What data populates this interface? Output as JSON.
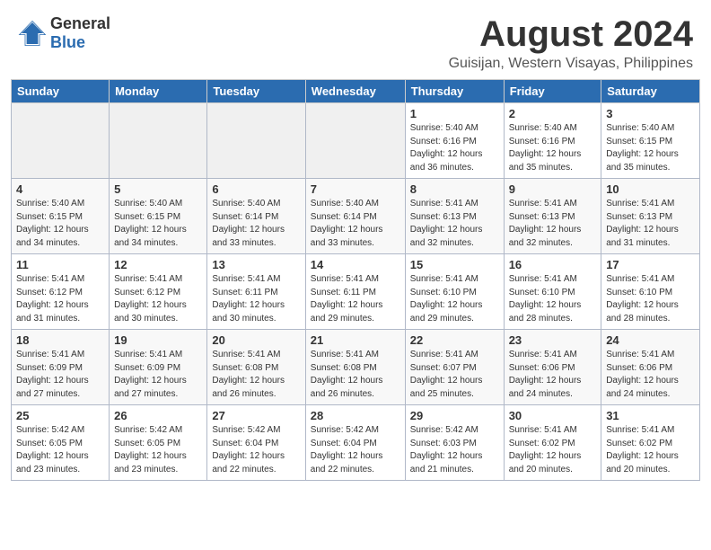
{
  "logo": {
    "general": "General",
    "blue": "Blue"
  },
  "title": {
    "month_year": "August 2024",
    "location": "Guisijan, Western Visayas, Philippines"
  },
  "headers": [
    "Sunday",
    "Monday",
    "Tuesday",
    "Wednesday",
    "Thursday",
    "Friday",
    "Saturday"
  ],
  "weeks": [
    [
      {
        "day": "",
        "info": ""
      },
      {
        "day": "",
        "info": ""
      },
      {
        "day": "",
        "info": ""
      },
      {
        "day": "",
        "info": ""
      },
      {
        "day": "1",
        "info": "Sunrise: 5:40 AM\nSunset: 6:16 PM\nDaylight: 12 hours\nand 36 minutes."
      },
      {
        "day": "2",
        "info": "Sunrise: 5:40 AM\nSunset: 6:16 PM\nDaylight: 12 hours\nand 35 minutes."
      },
      {
        "day": "3",
        "info": "Sunrise: 5:40 AM\nSunset: 6:15 PM\nDaylight: 12 hours\nand 35 minutes."
      }
    ],
    [
      {
        "day": "4",
        "info": "Sunrise: 5:40 AM\nSunset: 6:15 PM\nDaylight: 12 hours\nand 34 minutes."
      },
      {
        "day": "5",
        "info": "Sunrise: 5:40 AM\nSunset: 6:15 PM\nDaylight: 12 hours\nand 34 minutes."
      },
      {
        "day": "6",
        "info": "Sunrise: 5:40 AM\nSunset: 6:14 PM\nDaylight: 12 hours\nand 33 minutes."
      },
      {
        "day": "7",
        "info": "Sunrise: 5:40 AM\nSunset: 6:14 PM\nDaylight: 12 hours\nand 33 minutes."
      },
      {
        "day": "8",
        "info": "Sunrise: 5:41 AM\nSunset: 6:13 PM\nDaylight: 12 hours\nand 32 minutes."
      },
      {
        "day": "9",
        "info": "Sunrise: 5:41 AM\nSunset: 6:13 PM\nDaylight: 12 hours\nand 32 minutes."
      },
      {
        "day": "10",
        "info": "Sunrise: 5:41 AM\nSunset: 6:13 PM\nDaylight: 12 hours\nand 31 minutes."
      }
    ],
    [
      {
        "day": "11",
        "info": "Sunrise: 5:41 AM\nSunset: 6:12 PM\nDaylight: 12 hours\nand 31 minutes."
      },
      {
        "day": "12",
        "info": "Sunrise: 5:41 AM\nSunset: 6:12 PM\nDaylight: 12 hours\nand 30 minutes."
      },
      {
        "day": "13",
        "info": "Sunrise: 5:41 AM\nSunset: 6:11 PM\nDaylight: 12 hours\nand 30 minutes."
      },
      {
        "day": "14",
        "info": "Sunrise: 5:41 AM\nSunset: 6:11 PM\nDaylight: 12 hours\nand 29 minutes."
      },
      {
        "day": "15",
        "info": "Sunrise: 5:41 AM\nSunset: 6:10 PM\nDaylight: 12 hours\nand 29 minutes."
      },
      {
        "day": "16",
        "info": "Sunrise: 5:41 AM\nSunset: 6:10 PM\nDaylight: 12 hours\nand 28 minutes."
      },
      {
        "day": "17",
        "info": "Sunrise: 5:41 AM\nSunset: 6:10 PM\nDaylight: 12 hours\nand 28 minutes."
      }
    ],
    [
      {
        "day": "18",
        "info": "Sunrise: 5:41 AM\nSunset: 6:09 PM\nDaylight: 12 hours\nand 27 minutes."
      },
      {
        "day": "19",
        "info": "Sunrise: 5:41 AM\nSunset: 6:09 PM\nDaylight: 12 hours\nand 27 minutes."
      },
      {
        "day": "20",
        "info": "Sunrise: 5:41 AM\nSunset: 6:08 PM\nDaylight: 12 hours\nand 26 minutes."
      },
      {
        "day": "21",
        "info": "Sunrise: 5:41 AM\nSunset: 6:08 PM\nDaylight: 12 hours\nand 26 minutes."
      },
      {
        "day": "22",
        "info": "Sunrise: 5:41 AM\nSunset: 6:07 PM\nDaylight: 12 hours\nand 25 minutes."
      },
      {
        "day": "23",
        "info": "Sunrise: 5:41 AM\nSunset: 6:06 PM\nDaylight: 12 hours\nand 24 minutes."
      },
      {
        "day": "24",
        "info": "Sunrise: 5:41 AM\nSunset: 6:06 PM\nDaylight: 12 hours\nand 24 minutes."
      }
    ],
    [
      {
        "day": "25",
        "info": "Sunrise: 5:42 AM\nSunset: 6:05 PM\nDaylight: 12 hours\nand 23 minutes."
      },
      {
        "day": "26",
        "info": "Sunrise: 5:42 AM\nSunset: 6:05 PM\nDaylight: 12 hours\nand 23 minutes."
      },
      {
        "day": "27",
        "info": "Sunrise: 5:42 AM\nSunset: 6:04 PM\nDaylight: 12 hours\nand 22 minutes."
      },
      {
        "day": "28",
        "info": "Sunrise: 5:42 AM\nSunset: 6:04 PM\nDaylight: 12 hours\nand 22 minutes."
      },
      {
        "day": "29",
        "info": "Sunrise: 5:42 AM\nSunset: 6:03 PM\nDaylight: 12 hours\nand 21 minutes."
      },
      {
        "day": "30",
        "info": "Sunrise: 5:41 AM\nSunset: 6:02 PM\nDaylight: 12 hours\nand 20 minutes."
      },
      {
        "day": "31",
        "info": "Sunrise: 5:41 AM\nSunset: 6:02 PM\nDaylight: 12 hours\nand 20 minutes."
      }
    ]
  ]
}
